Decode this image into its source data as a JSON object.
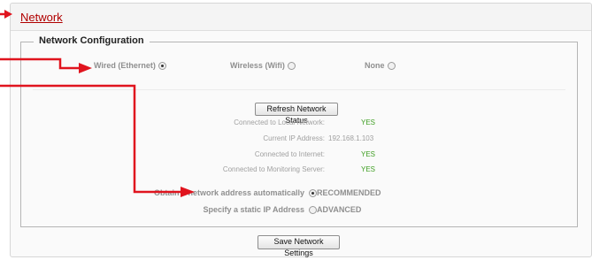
{
  "panel": {
    "title": "Network"
  },
  "config": {
    "legend": "Network Configuration",
    "connection_options": [
      {
        "label": "Wired (Ethernet)",
        "selected": true
      },
      {
        "label": "Wireless (Wifi)",
        "selected": false
      },
      {
        "label": "None",
        "selected": false
      }
    ]
  },
  "status": {
    "refresh_button": "Refresh Network Status",
    "rows": [
      {
        "label": "Connected to Local Network:",
        "value": "YES"
      },
      {
        "label": "Current IP Address:",
        "value": "192.168.1.103"
      },
      {
        "label": "Connected to Internet:",
        "value": "YES"
      },
      {
        "label": "Connected to Monitoring Server:",
        "value": "YES"
      }
    ]
  },
  "addressing": {
    "options": [
      {
        "label": "Obtain a network address automatically",
        "note": "RECOMMENDED",
        "selected": true
      },
      {
        "label": "Specify a static IP Address",
        "note": "ADVANCED",
        "selected": false
      }
    ]
  },
  "save_button": "Save Network Settings",
  "colors": {
    "annotation": "#e0141e",
    "link": "#b00000",
    "yes": "#3f9e22"
  }
}
